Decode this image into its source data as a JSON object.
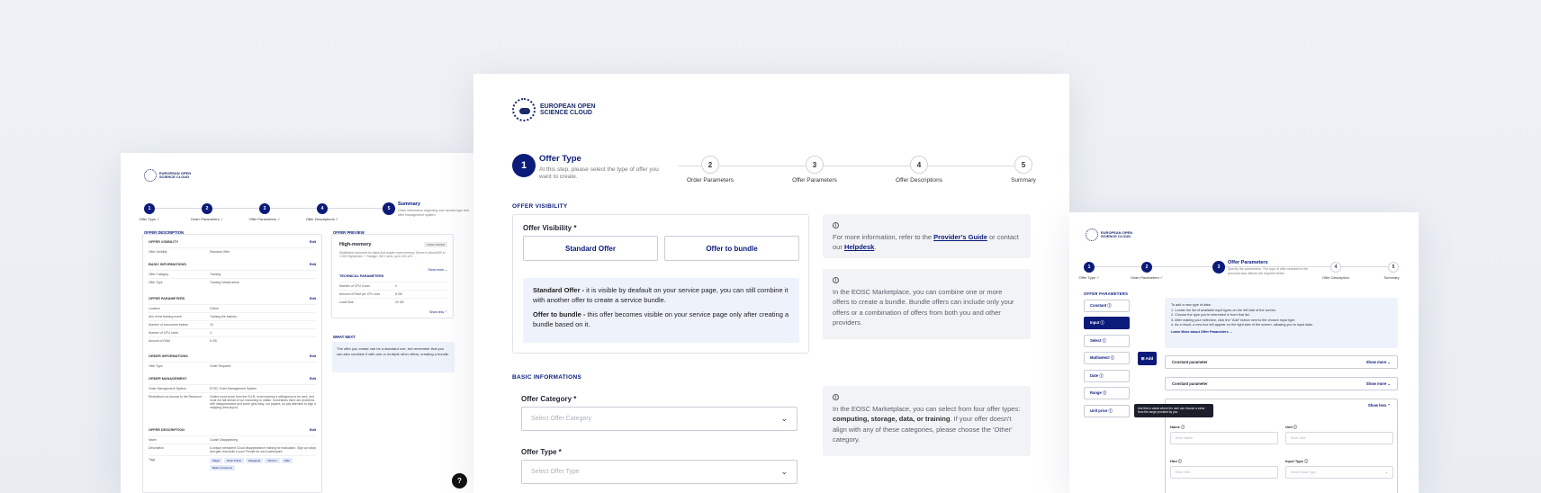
{
  "brand": {
    "line1": "EUROPEAN OPEN",
    "line2": "SCIENCE CLOUD"
  },
  "main": {
    "step1": {
      "num": "1",
      "title": "Offer Type",
      "desc": "At this step, please select the type of offer you want to create."
    },
    "steps": [
      {
        "num": "2",
        "label": "Order Parameters"
      },
      {
        "num": "3",
        "label": "Offer Parameters"
      },
      {
        "num": "4",
        "label": "Offer Descriptions"
      },
      {
        "num": "5",
        "label": "Summary"
      }
    ],
    "offer_visibility": {
      "heading": "OFFER VISIBILITY",
      "label": "Offer Visibility *",
      "option1": "Standard Offer",
      "option2": "Offer to bundle",
      "note_standard_lead": "Standard Offer -",
      "note_standard_text": " it is visible by deafault on your service page, you can still combine it with another offer to create a service bundle.",
      "note_bundle_lead": "Offer to bundle -",
      "note_bundle_text": " this offer becomes visible on your service page only after creating a bundle based on it."
    },
    "info1": {
      "pre": "For more information, refer to the ",
      "link1": "Provider's Guide",
      "mid": " or contact our ",
      "link2": "Helpdesk",
      "post": "."
    },
    "info2": {
      "text": "In the EOSC Marketplace, you can combine one or more offers to create a bundle. Bundle offers can include only your offers or a combination of offers from both you and other providers."
    },
    "basic": {
      "heading": "BASIC INFORMATIONS",
      "category_label": "Offer Category *",
      "category_placeholder": "Select Offer Category",
      "type_label": "Offer Type *",
      "type_placeholder": "Select Offer Type"
    },
    "info3": {
      "pre": "In the EOSC Marketplace, you can select from four offer types: ",
      "bold": "computing, storage, data, or training",
      "post": ". If your offer doesn't align with any of these categories, please choose the 'Other' category."
    }
  },
  "left": {
    "steps": [
      {
        "num": "1",
        "label": "Offer Type ✓"
      },
      {
        "num": "2",
        "label": "Order Parameters ✓"
      },
      {
        "num": "3",
        "label": "Offer Parameters ✓"
      },
      {
        "num": "4",
        "label": "Offer Descriptions ✓"
      },
      {
        "num": "5",
        "label": ""
      }
    ],
    "summary_title": "Summary",
    "summary_desc": "Order information regarding user access type and offer management system.",
    "offer_description": "OFFER DESCRIPTION",
    "offer_preview": "OFFER PREVIEW",
    "what_next": "WHAT NEXT",
    "edit": "Edit",
    "sections": [
      {
        "title": "OFFER VISIBILITY",
        "rows": [
          [
            "Offer Visibility",
            "Standard Offer"
          ]
        ]
      },
      {
        "title": "BASIC INFORMATIONS",
        "rows": [
          [
            "Offer Category",
            "Training"
          ],
          [
            "Offer Type",
            "Training Infrastructure"
          ]
        ]
      },
      {
        "title": "OFFER PARAMETERS",
        "rows": [
          [
            "Location",
            "Online"
          ],
          [
            "Aim of the training event",
            "Training the trainers"
          ],
          [
            "Number of concurrent trainee",
            "10"
          ],
          [
            "Number of CPU cores",
            "4"
          ],
          [
            "Amount of RAM",
            "8 GB"
          ]
        ]
      },
      {
        "title": "ORDER INFORMATIONS",
        "rows": [
          [
            "Offer Type",
            "Order Required"
          ]
        ]
      },
      {
        "title": "ORDER MANAGEMENT",
        "rows": [
          [
            "Order Management System",
            "EOSC Order Management System"
          ],
          [
            "Restrictions on Access to the Resource",
            "Orders must come from the EU-B, must express a willingness to be sent, and must not fall ahead of our reasoning to obtain. Sometimes there are problems with disappearance and some gets easy, our papers, so pay attention to sign a mapping area layout."
          ]
        ]
      },
      {
        "title": "OFFER DESCRIPTION",
        "rows": [
          [
            "Name",
            "Curate Disappearing"
          ],
          [
            "Description",
            "A unique persistent Cloud disappearance training for evaluation. Sign up today and gain real skills in your Private for each participant."
          ],
          [
            "Tags",
            ""
          ]
        ]
      }
    ],
    "tags": [
      "Magic",
      "Dirac Portal",
      "Disappear",
      "VR-Fox",
      "Offer",
      "Better Tomorrow"
    ],
    "preview": {
      "name": "High-memory",
      "badge": "FREE ORDER",
      "desc": "Distributed resources for tasks that require more memory. Server to about 500 to 1,000 Highpersec. + Storage, 500 Cores, up to 32h of E. ...",
      "show_more": "Show more ⌄",
      "tech_title": "TECHNICAL PARAMETERS",
      "rows": [
        [
          "Number of CPU Cores",
          "4"
        ],
        [
          "Amount of RAM per CPU core",
          "8 GB"
        ],
        [
          "Local Disk",
          "20 GB"
        ]
      ],
      "show_less": "Show less ⌃"
    },
    "what_next_text": "The offer you create can be a standard one, but remember that you can also combine it with one or multiple other offers, creating a bundle.",
    "help": "?"
  },
  "right": {
    "steps": [
      {
        "num": "1",
        "label": "Offer Type ✓"
      },
      {
        "num": "2",
        "label": "Order Parameters ✓"
      },
      {
        "num": "3",
        "label": ""
      },
      {
        "num": "4",
        "label": "Offer Description"
      },
      {
        "num": "5",
        "label": "Summary"
      }
    ],
    "step3_title": "Offer Parameters",
    "step3_desc": "Specify the parameters. The type of offer selected in the previous step affects the required fields.",
    "heading": "OFFER PARAMETERS",
    "types": [
      "Constant ⓘ",
      "Input ⓘ",
      "Select ⓘ",
      "Multiselect ⓘ",
      "Date ⓘ",
      "Range ⓘ",
      "Unit price ⓘ"
    ],
    "add": "⊞ Add",
    "howto": [
      "To add a new type of data:",
      "1. Locate the list of available input types on the left side of the screen.",
      "2. Choose the type you're interested in from that list.",
      "3. After making your selection, click the \"Add\" button next to the chosen input type.",
      "4. As a result, a new box will appear on the right side of the screen, allowing you to input data."
    ],
    "howto_link": "Learn More about Offer Parameters →",
    "params": [
      {
        "name": "Constant parameter",
        "action": "Show more ⌄"
      },
      {
        "name": "Constant parameter",
        "action": "Show more ⌄"
      }
    ],
    "show_less": "Show less ⌃",
    "tooltip": "Use this in cases where the user can choose a value from the range provided by you.",
    "fields": {
      "name_label": "Name ⓘ",
      "name_ph": "Enter Name",
      "unit_label": "Unit ⓘ",
      "unit_ph": "Enter Unit",
      "hint_label": "Hint ⓘ",
      "hint_ph": "Enter Hint",
      "input_type_label": "Input Type ⓘ",
      "input_type_ph": "Select Input Type"
    }
  }
}
